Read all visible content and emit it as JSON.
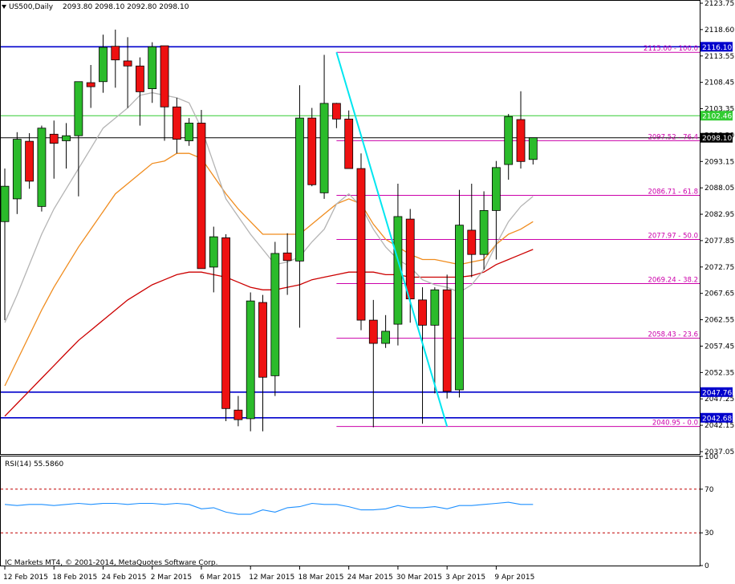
{
  "header": {
    "symbol": "US500,Daily",
    "ohlc": "2093.80 2098.10 2092.80 2098.10",
    "rsi_label": "RSI(14) 55.5860",
    "copyright": "IC Markets MT4, © 2001-2014, MetaQuotes Software Corp."
  },
  "colors": {
    "bull": "#2bbb2b",
    "bear": "#ee1111",
    "blue_line": "#0000cc",
    "fib": "#cc00aa",
    "trend": "#00e6f0",
    "ma_grey": "#b4b4b4",
    "ma_orange": "#f08c1e",
    "ma_red": "#cc0000",
    "rsi_line": "#1e90ff",
    "green_hline": "#33cc33"
  },
  "chart_data": [
    {
      "type": "candlestick",
      "title": "US500,Daily",
      "ylim": [
        2035.5,
        2125.2
      ],
      "y_ticks": [
        "2123.75",
        "2118.60",
        "2113.55",
        "2108.45",
        "2103.35",
        "2098.20",
        "2093.15",
        "2088.05",
        "2082.95",
        "2077.85",
        "2072.75",
        "2067.65",
        "2062.55",
        "2057.45",
        "2052.35",
        "2047.25",
        "2042.15",
        "2037.05"
      ],
      "x_tick_labels": [
        "12 Feb 2015",
        "18 Feb 2015",
        "24 Feb 2015",
        "2 Mar 2015",
        "6 Mar 2015",
        "12 Mar 2015",
        "18 Mar 2015",
        "24 Mar 2015",
        "30 Mar 2015",
        "3 Apr 2015",
        "9 Apr 2015"
      ],
      "x_tick_index": [
        0,
        4,
        8,
        12,
        16,
        20,
        24,
        28,
        32,
        36,
        40
      ],
      "candles": [
        {
          "o": 2081.5,
          "h": 2092.0,
          "l": 2062.0,
          "c": 2088.5
        },
        {
          "o": 2086.0,
          "h": 2099.2,
          "l": 2083.0,
          "c": 2097.8
        },
        {
          "o": 2097.4,
          "h": 2099.0,
          "l": 2088.0,
          "c": 2089.5
        },
        {
          "o": 2084.5,
          "h": 2100.5,
          "l": 2083.5,
          "c": 2100.0
        },
        {
          "o": 2098.8,
          "h": 2101.5,
          "l": 2090.0,
          "c": 2097.0
        },
        {
          "o": 2097.5,
          "h": 2101.0,
          "l": 2092.0,
          "c": 2098.5
        },
        {
          "o": 2098.5,
          "h": 2106.0,
          "l": 2086.5,
          "c": 2109.2
        },
        {
          "o": 2109.0,
          "h": 2112.5,
          "l": 2104.0,
          "c": 2108.2
        },
        {
          "o": 2109.2,
          "h": 2118.5,
          "l": 2107.0,
          "c": 2116.0
        },
        {
          "o": 2116.2,
          "h": 2119.5,
          "l": 2108.0,
          "c": 2113.5
        },
        {
          "o": 2113.3,
          "h": 2118.0,
          "l": 2104.0,
          "c": 2112.3
        },
        {
          "o": 2112.3,
          "h": 2114.0,
          "l": 2100.5,
          "c": 2107.2
        },
        {
          "o": 2107.8,
          "h": 2117.0,
          "l": 2105.0,
          "c": 2116.1
        },
        {
          "o": 2116.3,
          "h": 2116.3,
          "l": 2097.5,
          "c": 2104.2
        },
        {
          "o": 2104.2,
          "h": 2106.0,
          "l": 2095.0,
          "c": 2097.8
        },
        {
          "o": 2097.5,
          "h": 2102.0,
          "l": 2096.5,
          "c": 2101.0
        },
        {
          "o": 2101.0,
          "h": 2103.6,
          "l": 2086.5,
          "c": 2072.2
        },
        {
          "o": 2072.5,
          "h": 2080.5,
          "l": 2067.5,
          "c": 2078.5
        },
        {
          "o": 2078.3,
          "h": 2079.0,
          "l": 2042.0,
          "c": 2044.5
        },
        {
          "o": 2044.2,
          "h": 2047.0,
          "l": 2041.0,
          "c": 2042.3
        },
        {
          "o": 2042.5,
          "h": 2067.5,
          "l": 2040.0,
          "c": 2065.8
        },
        {
          "o": 2065.5,
          "h": 2067.0,
          "l": 2040.0,
          "c": 2050.7
        },
        {
          "o": 2051.0,
          "h": 2077.5,
          "l": 2047.0,
          "c": 2075.2
        },
        {
          "o": 2075.3,
          "h": 2079.2,
          "l": 2067.0,
          "c": 2073.8
        },
        {
          "o": 2073.7,
          "h": 2108.5,
          "l": 2060.5,
          "c": 2102.0
        },
        {
          "o": 2102.0,
          "h": 2104.0,
          "l": 2088.5,
          "c": 2088.8
        },
        {
          "o": 2087.2,
          "h": 2114.5,
          "l": 2086.0,
          "c": 2104.9
        },
        {
          "o": 2104.9,
          "h": 2105.0,
          "l": 2100.0,
          "c": 2101.8
        },
        {
          "o": 2101.8,
          "h": 2103.5,
          "l": 2092.0,
          "c": 2092.0
        },
        {
          "o": 2092.0,
          "h": 2095.0,
          "l": 2060.0,
          "c": 2062.0
        },
        {
          "o": 2062.0,
          "h": 2066.0,
          "l": 2040.8,
          "c": 2057.4
        },
        {
          "o": 2057.4,
          "h": 2063.0,
          "l": 2056.5,
          "c": 2059.8
        },
        {
          "o": 2061.2,
          "h": 2089.0,
          "l": 2057.0,
          "c": 2082.5
        },
        {
          "o": 2082.0,
          "h": 2084.0,
          "l": 2061.5,
          "c": 2066.2
        },
        {
          "o": 2066.0,
          "h": 2068.5,
          "l": 2041.5,
          "c": 2061.0
        },
        {
          "o": 2061.0,
          "h": 2068.5,
          "l": 2047.5,
          "c": 2068.0
        },
        {
          "o": 2068.0,
          "h": 2071.0,
          "l": 2046.5,
          "c": 2047.9
        },
        {
          "o": 2048.2,
          "h": 2087.8,
          "l": 2046.7,
          "c": 2080.8
        },
        {
          "o": 2079.8,
          "h": 2089.0,
          "l": 2070.5,
          "c": 2075.0
        },
        {
          "o": 2075.0,
          "h": 2087.5,
          "l": 2072.0,
          "c": 2083.7
        },
        {
          "o": 2083.7,
          "h": 2093.5,
          "l": 2074.0,
          "c": 2092.2
        },
        {
          "o": 2092.8,
          "h": 2102.8,
          "l": 2089.8,
          "c": 2102.3
        },
        {
          "o": 2101.7,
          "h": 2107.3,
          "l": 2092.0,
          "c": 2093.4
        },
        {
          "o": 2093.8,
          "h": 2098.1,
          "l": 2092.8,
          "c": 2098.1
        }
      ],
      "ma_grey": [
        2061.5,
        2067.0,
        2073.0,
        2079.0,
        2084.0,
        2088.0,
        2092.0,
        2096.0,
        2100.0,
        2102.0,
        2104.0,
        2106.5,
        2107.0,
        2106.5,
        2106.0,
        2105.0,
        2100.0,
        2093.0,
        2086.0,
        2082.5,
        2079.0,
        2076.0,
        2073.0,
        2073.5,
        2074.5,
        2077.5,
        2080.0,
        2085.0,
        2087.0,
        2084.5,
        2080.0,
        2076.5,
        2074.0,
        2072.5,
        2070.0,
        2069.0,
        2068.5,
        2067.5,
        2069.0,
        2072.0,
        2077.0,
        2081.5,
        2084.5,
        2086.5
      ],
      "ma_orange": [
        2049.0,
        2054.0,
        2059.0,
        2064.0,
        2068.5,
        2072.5,
        2076.5,
        2080.0,
        2083.5,
        2087.0,
        2089.0,
        2091.0,
        2093.0,
        2093.5,
        2095.0,
        2095.0,
        2094.0,
        2090.5,
        2087.0,
        2084.0,
        2081.5,
        2079.0,
        2079.0,
        2079.0,
        2079.0,
        2081.0,
        2083.0,
        2085.0,
        2086.0,
        2085.0,
        2081.0,
        2078.0,
        2076.5,
        2075.0,
        2074.0,
        2074.0,
        2073.5,
        2073.0,
        2073.5,
        2074.0,
        2077.0,
        2079.0,
        2080.0,
        2081.5
      ],
      "ma_red": [
        2043.0,
        2045.5,
        2048.0,
        2050.5,
        2053.0,
        2055.5,
        2058.0,
        2060.0,
        2062.0,
        2064.0,
        2066.0,
        2067.5,
        2069.0,
        2070.0,
        2071.0,
        2071.5,
        2071.5,
        2071.0,
        2070.5,
        2069.5,
        2068.5,
        2068.0,
        2068.0,
        2068.5,
        2069.0,
        2070.0,
        2070.5,
        2071.0,
        2071.5,
        2071.5,
        2071.5,
        2071.0,
        2071.0,
        2070.5,
        2070.5,
        2070.5,
        2070.5,
        2070.5,
        2070.8,
        2071.5,
        2073.0,
        2074.0,
        2075.0,
        2076.0
      ],
      "horizontal_lines": [
        {
          "kind": "blue",
          "value": 2116.1,
          "label": "2116.10"
        },
        {
          "kind": "blue",
          "value": 2047.76,
          "label": "2047.76"
        },
        {
          "kind": "blue",
          "value": 2042.68,
          "label": "2042.68"
        },
        {
          "kind": "green",
          "value": 2102.46,
          "label": "2102.46"
        },
        {
          "kind": "black",
          "value": 2098.1,
          "label": "2098.10"
        }
      ],
      "fib_levels": [
        {
          "value": 2115.0,
          "label": "2115.00 - 100.0"
        },
        {
          "value": 2097.52,
          "label": "2097.52 - 76.4"
        },
        {
          "value": 2086.71,
          "label": "2086.71 - 61.8"
        },
        {
          "value": 2077.97,
          "label": "2077.97 - 50.0"
        },
        {
          "value": 2069.24,
          "label": "2069.24 - 38.2"
        },
        {
          "value": 2058.43,
          "label": "2058.43 - 23.6"
        },
        {
          "value": 2040.95,
          "label": "2040.95 - 0.0"
        }
      ],
      "fib_start_index": 27,
      "trendline": {
        "from": {
          "i": 27,
          "y": 2115.0
        },
        "to": {
          "i": 36,
          "y": 2040.95
        }
      }
    },
    {
      "type": "line",
      "title": "RSI(14) 55.5860",
      "ylim": [
        0,
        100
      ],
      "y_ticks": [
        "100",
        "70",
        "30",
        "0"
      ],
      "levels": [
        70,
        30
      ],
      "values": [
        56,
        55,
        56,
        56,
        55,
        56,
        57,
        56,
        57,
        57,
        56,
        57,
        57,
        56,
        57,
        56,
        52,
        53,
        49,
        47,
        47,
        51,
        49,
        53,
        54,
        57,
        56,
        56,
        54,
        51,
        51,
        52,
        55,
        53,
        53,
        54,
        52,
        55,
        55,
        56,
        57,
        58,
        56,
        56
      ]
    }
  ]
}
